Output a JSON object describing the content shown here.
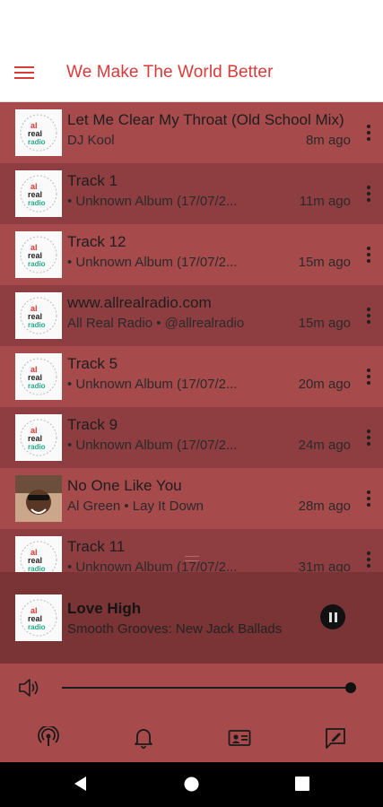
{
  "header": {
    "title": "We Make The World Better",
    "menu_icon": "hamburger-menu-icon"
  },
  "tracks": [
    {
      "title": "Let Me Clear My Throat (Old School Mix)",
      "subtitle": "DJ Kool",
      "time": "8m ago",
      "art": "allrealradio-logo"
    },
    {
      "title": "Track 1",
      "subtitle": "• Unknown Album (17/07/2...",
      "time": "11m ago",
      "art": "allrealradio-logo"
    },
    {
      "title": "Track 12",
      "subtitle": "• Unknown Album (17/07/2...",
      "time": "15m ago",
      "art": "allrealradio-logo"
    },
    {
      "title": "www.allrealradio.com",
      "subtitle": "All Real Radio • @allrealradio",
      "time": "15m ago",
      "art": "allrealradio-logo"
    },
    {
      "title": "Track 5",
      "subtitle": "• Unknown Album (17/07/2...",
      "time": "20m ago",
      "art": "allrealradio-logo"
    },
    {
      "title": "Track 9",
      "subtitle": "• Unknown Album (17/07/2...",
      "time": "24m ago",
      "art": "allrealradio-logo"
    },
    {
      "title": "No One Like You",
      "subtitle": "Al Green • Lay It Down",
      "time": "28m ago",
      "art": "al-green-photo"
    },
    {
      "title": "Track 11",
      "subtitle": "• Unknown Album (17/07/2...",
      "time": "31m ago",
      "art": "allrealradio-logo"
    }
  ],
  "now_playing": {
    "title": "Love High",
    "subtitle": "Smooth Grooves: New Jack Ballads",
    "state": "playing"
  },
  "volume": {
    "level": 1.0,
    "icon": "speaker-icon"
  },
  "bottom_nav": [
    "podcast-icon",
    "bell-icon",
    "id-card-icon",
    "chat-edit-icon"
  ],
  "colors": {
    "accent": "#d93a3a",
    "row_light": "#a64a4c",
    "row_dark": "#8e3e41",
    "player_bg": "#7a3436"
  }
}
